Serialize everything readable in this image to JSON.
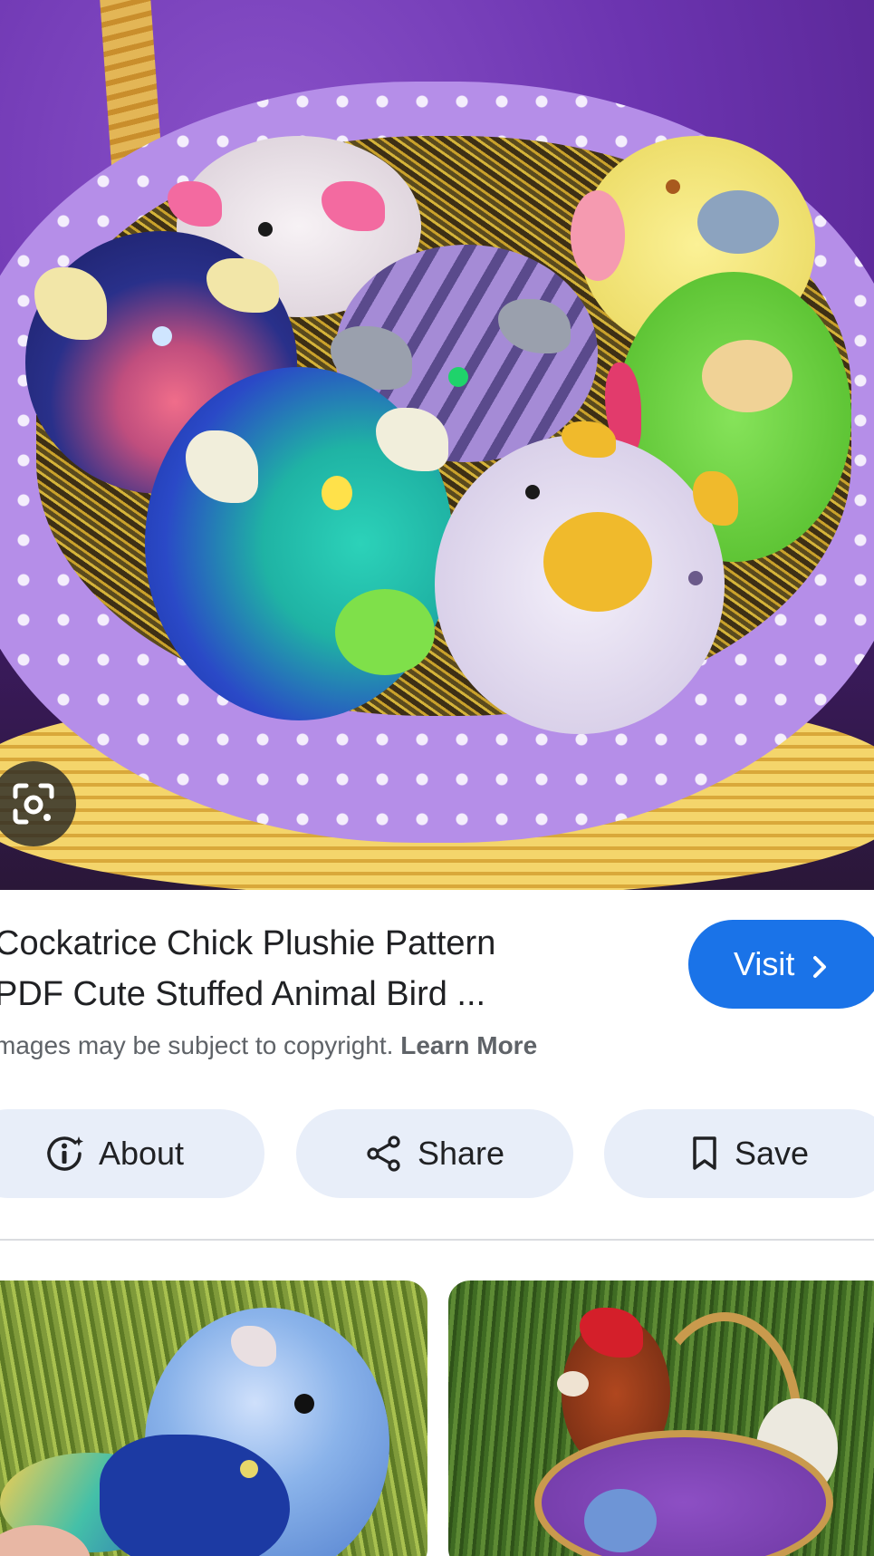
{
  "result": {
    "title_lines": [
      "Cockatrice Chick Plushie Pattern",
      "PDF Cute Stuffed Animal Bird ..."
    ],
    "visit_label": "Visit",
    "copyright_text": "mages may be subject to copyright. ",
    "learn_more_label": "Learn More"
  },
  "actions": [
    {
      "label": "About",
      "icon": "info-sparkle-icon"
    },
    {
      "label": "Share",
      "icon": "share-icon"
    },
    {
      "label": "Save",
      "icon": "bookmark-icon"
    }
  ],
  "icons": {
    "lens": "google-lens-icon",
    "visit": "chevron-right-icon"
  },
  "colors": {
    "visit_button": "#1a73e8",
    "action_chip": "#e8eef9",
    "secondary_text": "#5f6368"
  }
}
